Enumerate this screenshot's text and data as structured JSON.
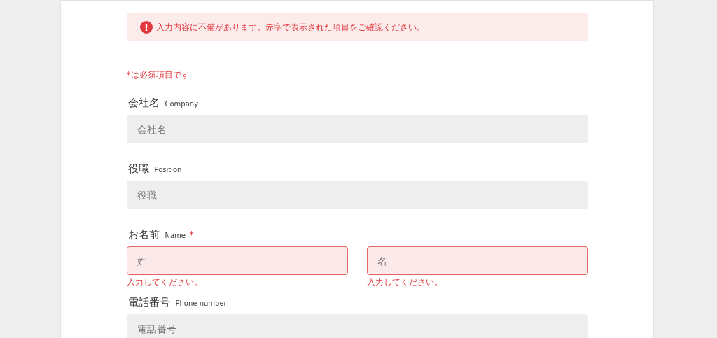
{
  "alert": {
    "message": "入力内容に不備があります。赤字で表示された項目をご確認ください。"
  },
  "required_note": "*は必須項目です",
  "fields": [
    {
      "label": "会社名",
      "label_en": "Company",
      "inputs": [
        {
          "placeholder": "会社名",
          "invalid": false
        }
      ]
    },
    {
      "label": "役職",
      "label_en": "Position",
      "inputs": [
        {
          "placeholder": "役職",
          "invalid": false
        }
      ]
    },
    {
      "label": "お名前",
      "label_en": "Name",
      "required_mark": "*",
      "inputs": [
        {
          "placeholder": "姓",
          "invalid": true,
          "error": "入力してください。"
        },
        {
          "placeholder": "名",
          "invalid": true,
          "error": "入力してください。"
        }
      ]
    },
    {
      "label": "電話番号",
      "label_en": "Phone number",
      "inputs": [
        {
          "placeholder": "電話番号",
          "invalid": false
        }
      ]
    }
  ]
}
